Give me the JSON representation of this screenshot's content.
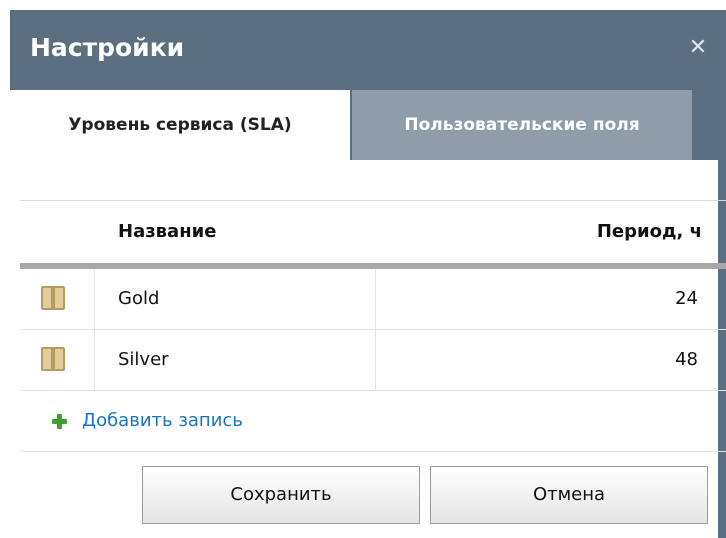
{
  "dialog": {
    "title": "Настройки",
    "close_icon": "close-icon"
  },
  "tabs": [
    {
      "label": "Уровень сервиса (SLA)",
      "active": true
    },
    {
      "label": "Пользовательские поля",
      "active": false
    }
  ],
  "table": {
    "columns": [
      "Название",
      "Период, ч"
    ],
    "rows": [
      {
        "icon": "box-icon",
        "name": "Gold",
        "period": "24"
      },
      {
        "icon": "box-icon",
        "name": "Silver",
        "period": "48"
      }
    ]
  },
  "add_record": {
    "icon": "plus-icon",
    "label": "Добавить запись"
  },
  "buttons": {
    "save": "Сохранить",
    "cancel": "Отмена"
  },
  "colors": {
    "header": "#5c6f80",
    "inactive_tab": "#8f9dab",
    "link": "#1a73c8",
    "plus": "#3aa32e"
  }
}
